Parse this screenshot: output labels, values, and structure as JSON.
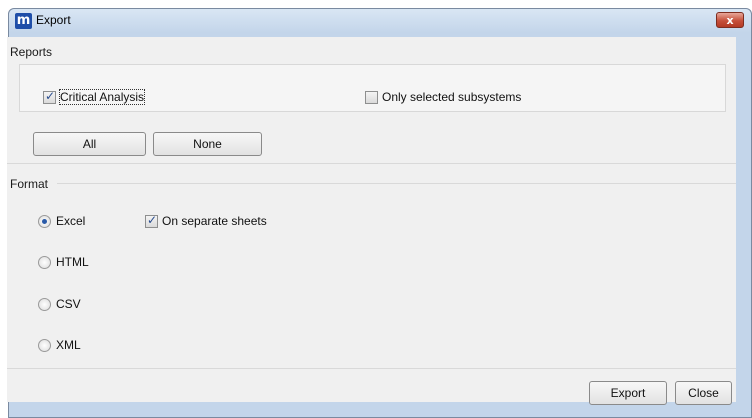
{
  "window": {
    "title": "Export",
    "close_label": "x",
    "app_icon_letter": "m"
  },
  "reports": {
    "label": "Reports",
    "critical_analysis": {
      "label": "Critical Analysis",
      "checked": true
    },
    "only_selected_subsystems": {
      "label": "Only selected subsystems",
      "checked": false
    },
    "all_label": "All",
    "none_label": "None"
  },
  "format": {
    "label": "Format",
    "options": [
      {
        "label": "Excel",
        "selected": true
      },
      {
        "label": "HTML",
        "selected": false
      },
      {
        "label": "CSV",
        "selected": false
      },
      {
        "label": "XML",
        "selected": false
      }
    ],
    "separate_sheets": {
      "label": "On separate sheets",
      "checked": true
    }
  },
  "footer": {
    "export_label": "Export",
    "close_label": "Close"
  }
}
